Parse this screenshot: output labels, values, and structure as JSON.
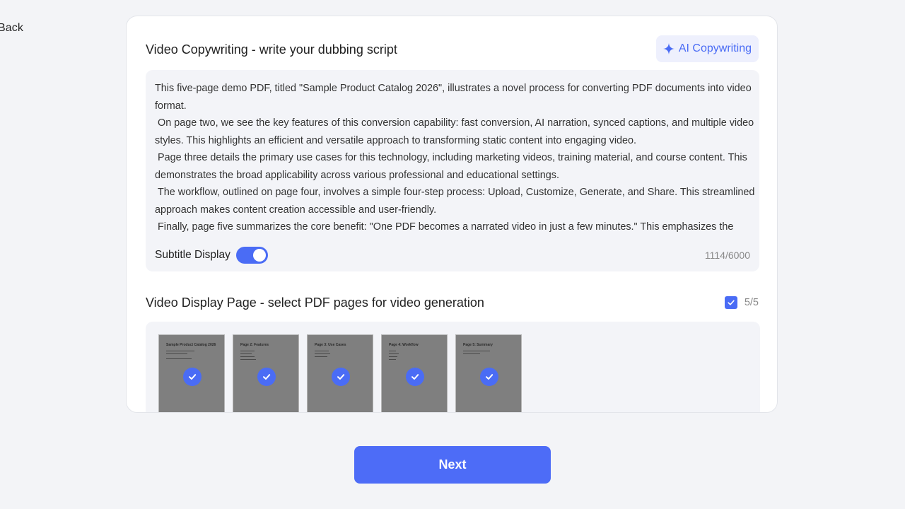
{
  "nav": {
    "back_label": "Back"
  },
  "copywriting": {
    "title": "Video Copywriting - write your dubbing script",
    "ai_button_label": "AI Copywriting",
    "ai_button_icon": "sparkle-icon",
    "script_text": "This five-page demo PDF, titled \"Sample Product Catalog 2026\", illustrates a novel process for converting PDF documents into video format.\n On page two, we see the key features of this conversion capability: fast conversion, AI narration, synced captions, and multiple video styles. This highlights an efficient and versatile approach to transforming static content into engaging video.\n Page three details the primary use cases for this technology, including marketing videos, training material, and course content. This demonstrates the broad applicability across various professional and educational settings.\n The workflow, outlined on page four, involves a simple four-step process: Upload, Customize, Generate, and Share. This streamlined approach makes content creation accessible and user-friendly.\n Finally, page five summarizes the core benefit: \"One PDF becomes a narrated video in just a few minutes.\" This emphasizes the",
    "subtitle_label": "Subtitle Display",
    "subtitle_enabled": true,
    "char_count": "1114/6000"
  },
  "pages": {
    "title": "Video Display Page - select PDF pages for video generation",
    "selected_count": "5/5",
    "all_selected": true,
    "thumbnails": [
      {
        "title": "Sample Product Catalog 2026",
        "selected": true
      },
      {
        "title": "Page 2: Features",
        "selected": true
      },
      {
        "title": "Page 3: Use Cases",
        "selected": true
      },
      {
        "title": "Page 4: Workflow",
        "selected": true
      },
      {
        "title": "Page 5: Summary",
        "selected": true
      }
    ]
  },
  "footer": {
    "next_label": "Next"
  },
  "colors": {
    "accent": "#4a6cf5",
    "background": "#f3f4f7",
    "thumbnail": "#7f7f7f"
  }
}
